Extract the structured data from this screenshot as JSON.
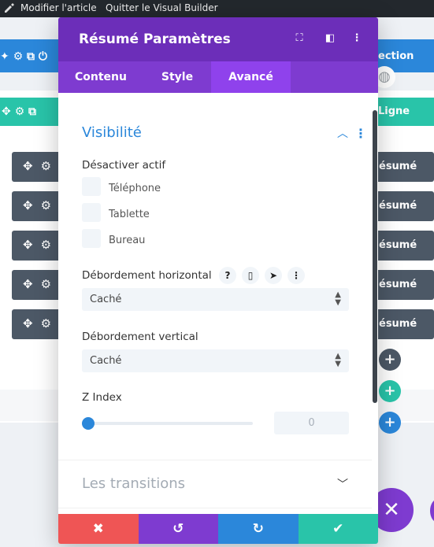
{
  "admin_bar": {
    "edit_article": "Modifier l'article",
    "quit_builder": "Quitter le Visual Builder"
  },
  "background": {
    "section_label": "ection",
    "row_label": "Ligne",
    "module_label": "ésumé",
    "module_count": 5
  },
  "modal": {
    "title": "Résumé Paramètres",
    "tabs": [
      {
        "label": "Contenu",
        "active": false
      },
      {
        "label": "Style",
        "active": false
      },
      {
        "label": "Avancé",
        "active": true
      }
    ],
    "visibility": {
      "title": "Visibilité",
      "disable_label": "Désactiver actif",
      "options": [
        {
          "label": "Téléphone",
          "checked": false
        },
        {
          "label": "Tablette",
          "checked": false
        },
        {
          "label": "Bureau",
          "checked": false
        }
      ],
      "overflow_h_label": "Débordement horizontal",
      "overflow_h_value": "Caché",
      "overflow_v_label": "Débordement vertical",
      "overflow_v_value": "Caché",
      "zindex_label": "Z Index",
      "zindex_value": "0",
      "zindex_slider_fraction": 0
    },
    "transitions": {
      "title": "Les transitions"
    }
  },
  "colors": {
    "header_purple": "#6c2eb9",
    "tab_purple": "#7e3bd0",
    "accent_blue": "#2b87da",
    "row_green": "#29c4a9",
    "cancel_red": "#ef5555",
    "undo_purple": "#7e3bd0",
    "redo_blue": "#2b87da",
    "save_green": "#29c4a9"
  },
  "icons": {
    "header": [
      "expand-icon",
      "columns-icon",
      "more-icon"
    ],
    "footer": [
      "close-icon",
      "undo-icon",
      "redo-icon",
      "check-icon"
    ],
    "overflow_controls": [
      "help-icon",
      "phone-icon",
      "hover-cursor-icon",
      "more-icon"
    ]
  }
}
